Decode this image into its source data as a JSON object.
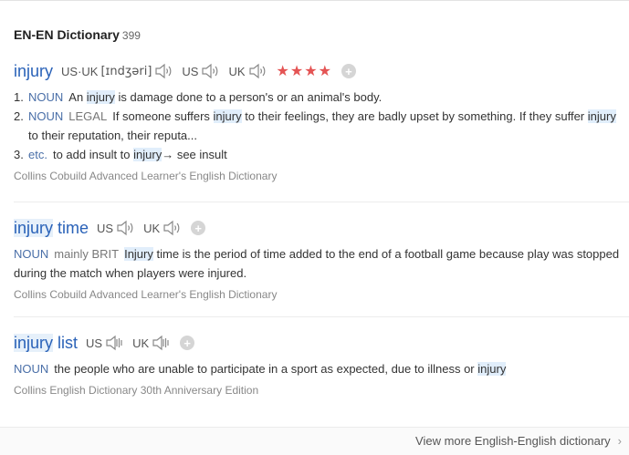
{
  "header": {
    "title": "EN-EN Dictionary",
    "count": "399"
  },
  "entries": [
    {
      "word": "injury",
      "pron": [
        {
          "lang": "US·UK",
          "phonetic": "[ɪndʒəri]"
        },
        {
          "lang": "US"
        },
        {
          "lang": "UK"
        }
      ],
      "stars": "★★★★",
      "defs": [
        {
          "num": "1.",
          "pos": "NOUN",
          "parts": [
            "An ",
            "injury",
            " is damage done to a person's or an animal's body."
          ]
        },
        {
          "num": "2.",
          "pos": "NOUN",
          "register": "LEGAL",
          "parts": [
            "If someone suffers ",
            "injury",
            " to their feelings, they are badly upset by something. If they suffer ",
            "injury",
            " to their reputation, their reputa..."
          ]
        },
        {
          "num": "3.",
          "pos": "etc.",
          "parts": [
            "to add insult to ",
            "injury",
            "→ see insult"
          ]
        }
      ],
      "source": "Collins Cobuild Advanced Learner's English Dictionary"
    },
    {
      "word_a": "injury",
      "word_b": " time",
      "pron": [
        {
          "lang": "US"
        },
        {
          "lang": "UK"
        }
      ],
      "def": {
        "pos": "NOUN",
        "register": "mainly BRIT",
        "parts": [
          "Injury",
          " time is the period of time added to the end of a football game because play was stopped during the match when players were injured."
        ]
      },
      "source": "Collins Cobuild Advanced Learner's English Dictionary"
    },
    {
      "word_a": "injury",
      "word_b": " list",
      "pron": [
        {
          "lang": "US"
        },
        {
          "lang": "UK"
        }
      ],
      "def": {
        "pos": "NOUN",
        "parts": [
          "the people who are unable to participate in a sport as expected, due to illness or ",
          "injury"
        ]
      },
      "source": "Collins English Dictionary 30th Anniversary Edition"
    }
  ],
  "footer": {
    "more_label": "View more English-English dictionary"
  },
  "colors": {
    "link": "#2a62b8",
    "stars": "#e45454",
    "highlight": "#e1eefb"
  },
  "icons": {
    "speaker": "speaker-icon",
    "add": "plus-icon",
    "more": "chevron-right-icon"
  }
}
